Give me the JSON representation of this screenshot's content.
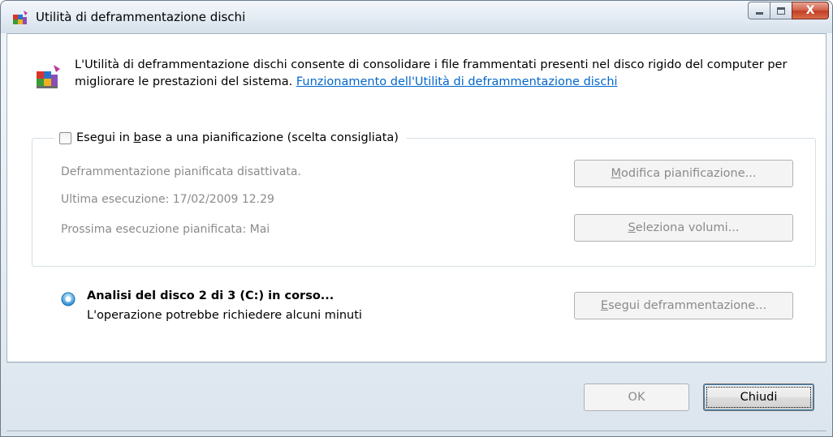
{
  "window": {
    "title": "Utilità di deframmentazione dischi",
    "controls": {
      "minimize": "minimize-icon",
      "maximize": "maximize-icon",
      "close": "X"
    }
  },
  "intro": {
    "text": "L'Utilità di deframmentazione dischi consente di consolidare i file frammentati presenti nel disco rigido del computer per migliorare le prestazioni del sistema.",
    "link": "Funzionamento dell'Utilità di deframmentazione dischi"
  },
  "schedule": {
    "checkbox_prefix": "Esegui in ",
    "checkbox_accel": "b",
    "checkbox_suffix": "ase a una pianificazione (scelta consigliata)",
    "checked": false,
    "status": "Deframmentazione pianificata disattivata.",
    "last_run": "Ultima esecuzione: 17/02/2009 12.29",
    "next_run": "Prossima esecuzione pianificata: Mai",
    "modify_button": {
      "accel": "M",
      "rest": "odifica pianificazione..."
    },
    "volumes_button": {
      "accel": "S",
      "rest": "eleziona volumi..."
    }
  },
  "progress": {
    "title": "Analisi del disco 2 di 3 (C:) in corso...",
    "subtitle": "L'operazione potrebbe richiedere alcuni minuti",
    "run_button": {
      "accel": "E",
      "rest": "segui deframmentazione..."
    }
  },
  "footer": {
    "ok_label": "OK",
    "close_label": "Chiudi"
  },
  "colors": {
    "link": "#0066cc",
    "disabled_text": "#8b8b8b",
    "frame": "#dce5ee"
  }
}
